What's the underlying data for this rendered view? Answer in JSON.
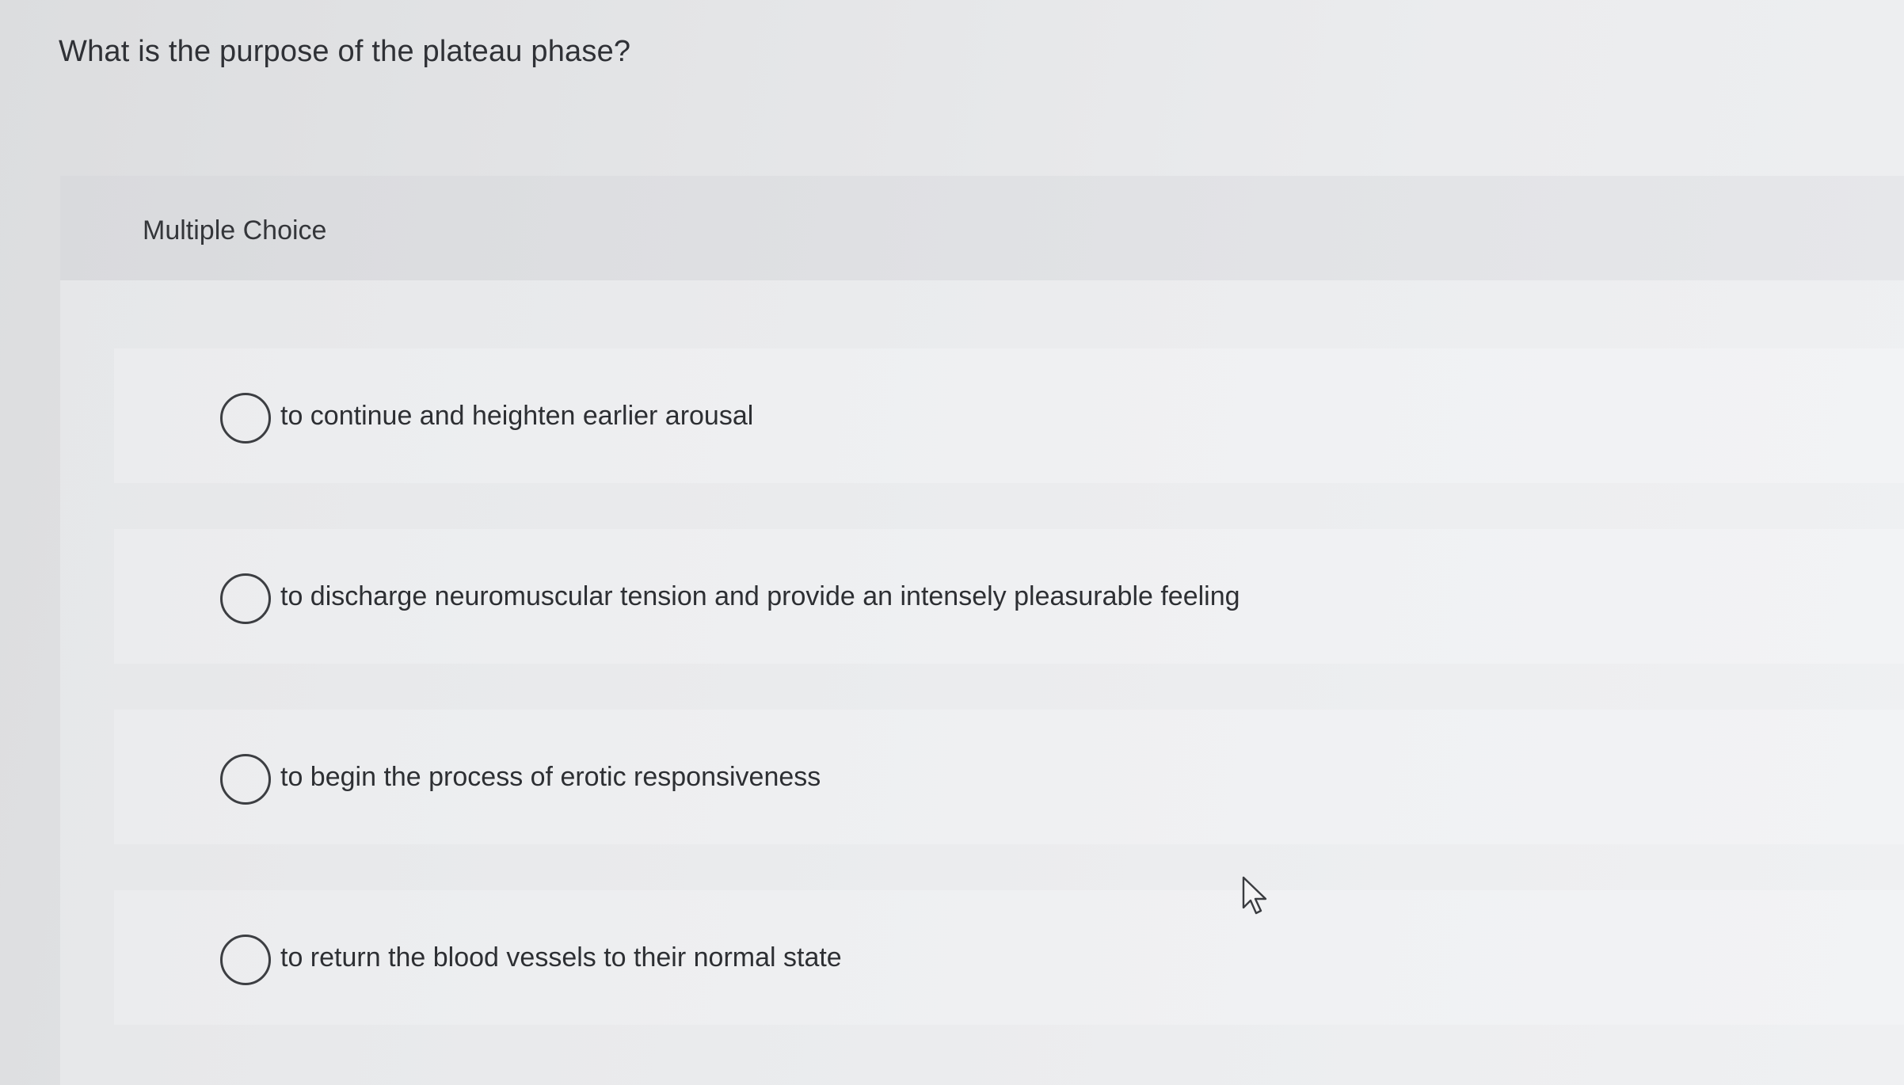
{
  "question": {
    "text": "What is the purpose of the plateau phase?"
  },
  "panel": {
    "header_label": "Multiple Choice",
    "options": [
      {
        "label": "to continue and heighten earlier arousal",
        "selected": false
      },
      {
        "label": "to discharge neuromuscular tension and provide an intensely pleasurable feeling",
        "selected": false
      },
      {
        "label": "to begin the process of erotic responsiveness",
        "selected": false
      },
      {
        "label": "to return the blood vessels to their normal state",
        "selected": false
      }
    ]
  },
  "icons": {
    "radio": "radio-button-icon",
    "cursor": "mouse-pointer-icon"
  }
}
